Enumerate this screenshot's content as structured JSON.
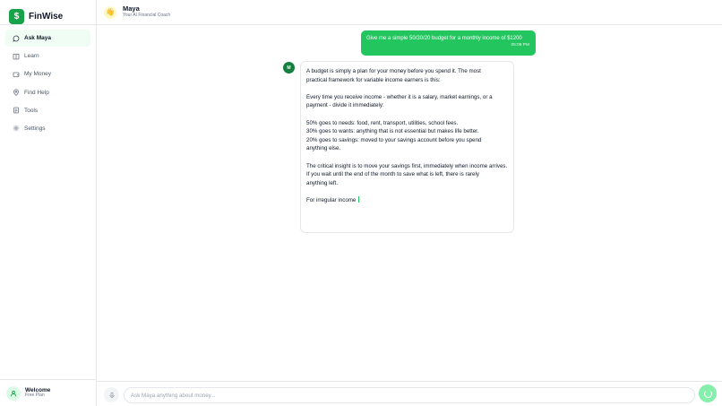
{
  "app": {
    "name": "FinWise",
    "logo_icon": "money-bag-icon",
    "accent": "#22c55e"
  },
  "sidebar": {
    "items": [
      {
        "label": "Ask Maya",
        "icon": "chat-bubble-icon",
        "active": true
      },
      {
        "label": "Learn",
        "icon": "book-icon",
        "active": false
      },
      {
        "label": "My Money",
        "icon": "wallet-icon",
        "active": false
      },
      {
        "label": "Find Help",
        "icon": "location-pin-icon",
        "active": false
      },
      {
        "label": "Tools",
        "icon": "document-icon",
        "active": false
      },
      {
        "label": "Settings",
        "icon": "gear-icon",
        "active": false
      }
    ],
    "user": {
      "name": "Welcome",
      "plan": "Free Plan",
      "icon": "user-icon"
    }
  },
  "header": {
    "title": "Maya",
    "subtitle": "Your AI Financial Coach",
    "avatar_icon": "waving-hand-icon"
  },
  "chat": {
    "user_message": {
      "text": "Give me a simple 50/30/20 budget for a monthly income of $1200",
      "time": "05:08 PM"
    },
    "assistant": {
      "avatar_letter": "M",
      "lines": [
        "A budget is simply a plan for your money before you spend it. The most",
        "practical framework for variable income earners is this:",
        "",
        "Every time you receive income - whether it is a salary, market earnings, or a",
        "payment - divide it immediately:",
        "",
        "50% goes to needs: food, rent, transport, utilities, school fees.",
        "30% goes to wants: anything that is not essential but makes life better.",
        "20% goes to savings: moved to your savings account before you spend",
        "anything else.",
        "",
        "The critical insight is to move your savings first, immediately when income arrives.",
        "If you wait until the end of the month to save what is left, there is rarely",
        "anything left.",
        "",
        "For irregular income"
      ]
    }
  },
  "composer": {
    "placeholder": "Ask Maya anything about money...",
    "value": "",
    "mic_icon": "microphone-icon",
    "send_icon": "loading-spinner-icon"
  }
}
